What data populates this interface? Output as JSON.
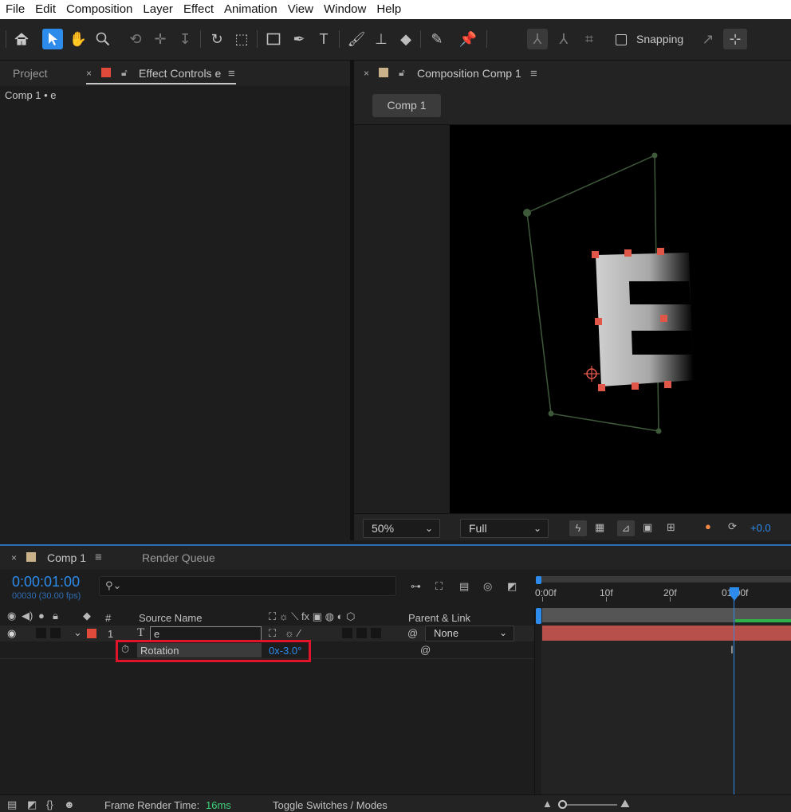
{
  "menu": [
    "File",
    "Edit",
    "Composition",
    "Layer",
    "Effect",
    "Animation",
    "View",
    "Window",
    "Help"
  ],
  "toolbar": {
    "snapping_label": "Snapping"
  },
  "left_panel": {
    "tab_project": "Project",
    "tab_effect_controls": "Effect Controls e",
    "breadcrumb": "Comp 1 • e",
    "swatch_color": "#e04a3a"
  },
  "comp_panel": {
    "tab_title": "Composition Comp 1",
    "comp_button": "Comp 1",
    "swatch_color": "#c9b28a",
    "zoom": "50%",
    "resolution": "Full",
    "exposure": "+0.0"
  },
  "timeline": {
    "tab_title": "Comp 1",
    "render_queue": "Render Queue",
    "timecode": "0:00:01:00",
    "frame_info": "00030 (30.00 fps)",
    "col_number": "#",
    "col_source_name": "Source Name",
    "col_parent": "Parent & Link",
    "ruler": [
      "0:00f",
      "10f",
      "20f",
      "01:00f"
    ],
    "layer": {
      "index": "1",
      "name": "e",
      "parent": "None"
    },
    "property": {
      "name": "Rotation",
      "value": "0x-3.0°"
    },
    "footer": {
      "frame_render_label": "Frame Render Time:",
      "frame_render_value": "16ms",
      "toggle": "Toggle Switches / Modes"
    }
  },
  "colors": {
    "accent_blue": "#2d8ceb",
    "layer_bar": "#b7504a",
    "highlight_red": "#e0142a",
    "handle": "#e0574a"
  }
}
